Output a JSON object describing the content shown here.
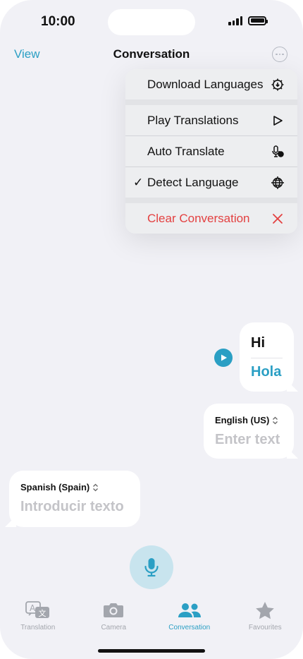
{
  "status_bar": {
    "time": "10:00"
  },
  "nav": {
    "left_label": "View",
    "title": "Conversation",
    "more_icon": "ellipsis-circle-icon"
  },
  "menu": {
    "items": [
      {
        "label": "Download Languages",
        "icon": "gear-download-icon",
        "checked": false
      },
      {
        "label": "Play Translations",
        "icon": "play-outline-icon",
        "checked": false
      },
      {
        "label": "Auto Translate",
        "icon": "mic-auto-icon",
        "checked": false
      },
      {
        "label": "Detect Language",
        "icon": "globe-detect-icon",
        "checked": true
      },
      {
        "label": "Clear Conversation",
        "icon": "close-x-icon",
        "checked": false,
        "color": "#e34040"
      }
    ],
    "check_mark": "✓"
  },
  "conversation": {
    "message": {
      "original": "Hi",
      "translation": "Hola"
    },
    "english_box": {
      "language": "English (US)",
      "placeholder": "Enter text"
    },
    "spanish_box": {
      "language": "Spanish (Spain)",
      "placeholder": "Introducir texto"
    }
  },
  "tabbar": {
    "tabs": [
      {
        "label": "Translation",
        "icon": "translate-icon",
        "active": false
      },
      {
        "label": "Camera",
        "icon": "camera-icon",
        "active": false
      },
      {
        "label": "Conversation",
        "icon": "people-icon",
        "active": true
      },
      {
        "label": "Favourites",
        "icon": "star-icon",
        "active": false
      }
    ]
  },
  "colors": {
    "accent": "#2b9fc4",
    "danger": "#e34040",
    "background": "#f1f1f6"
  }
}
